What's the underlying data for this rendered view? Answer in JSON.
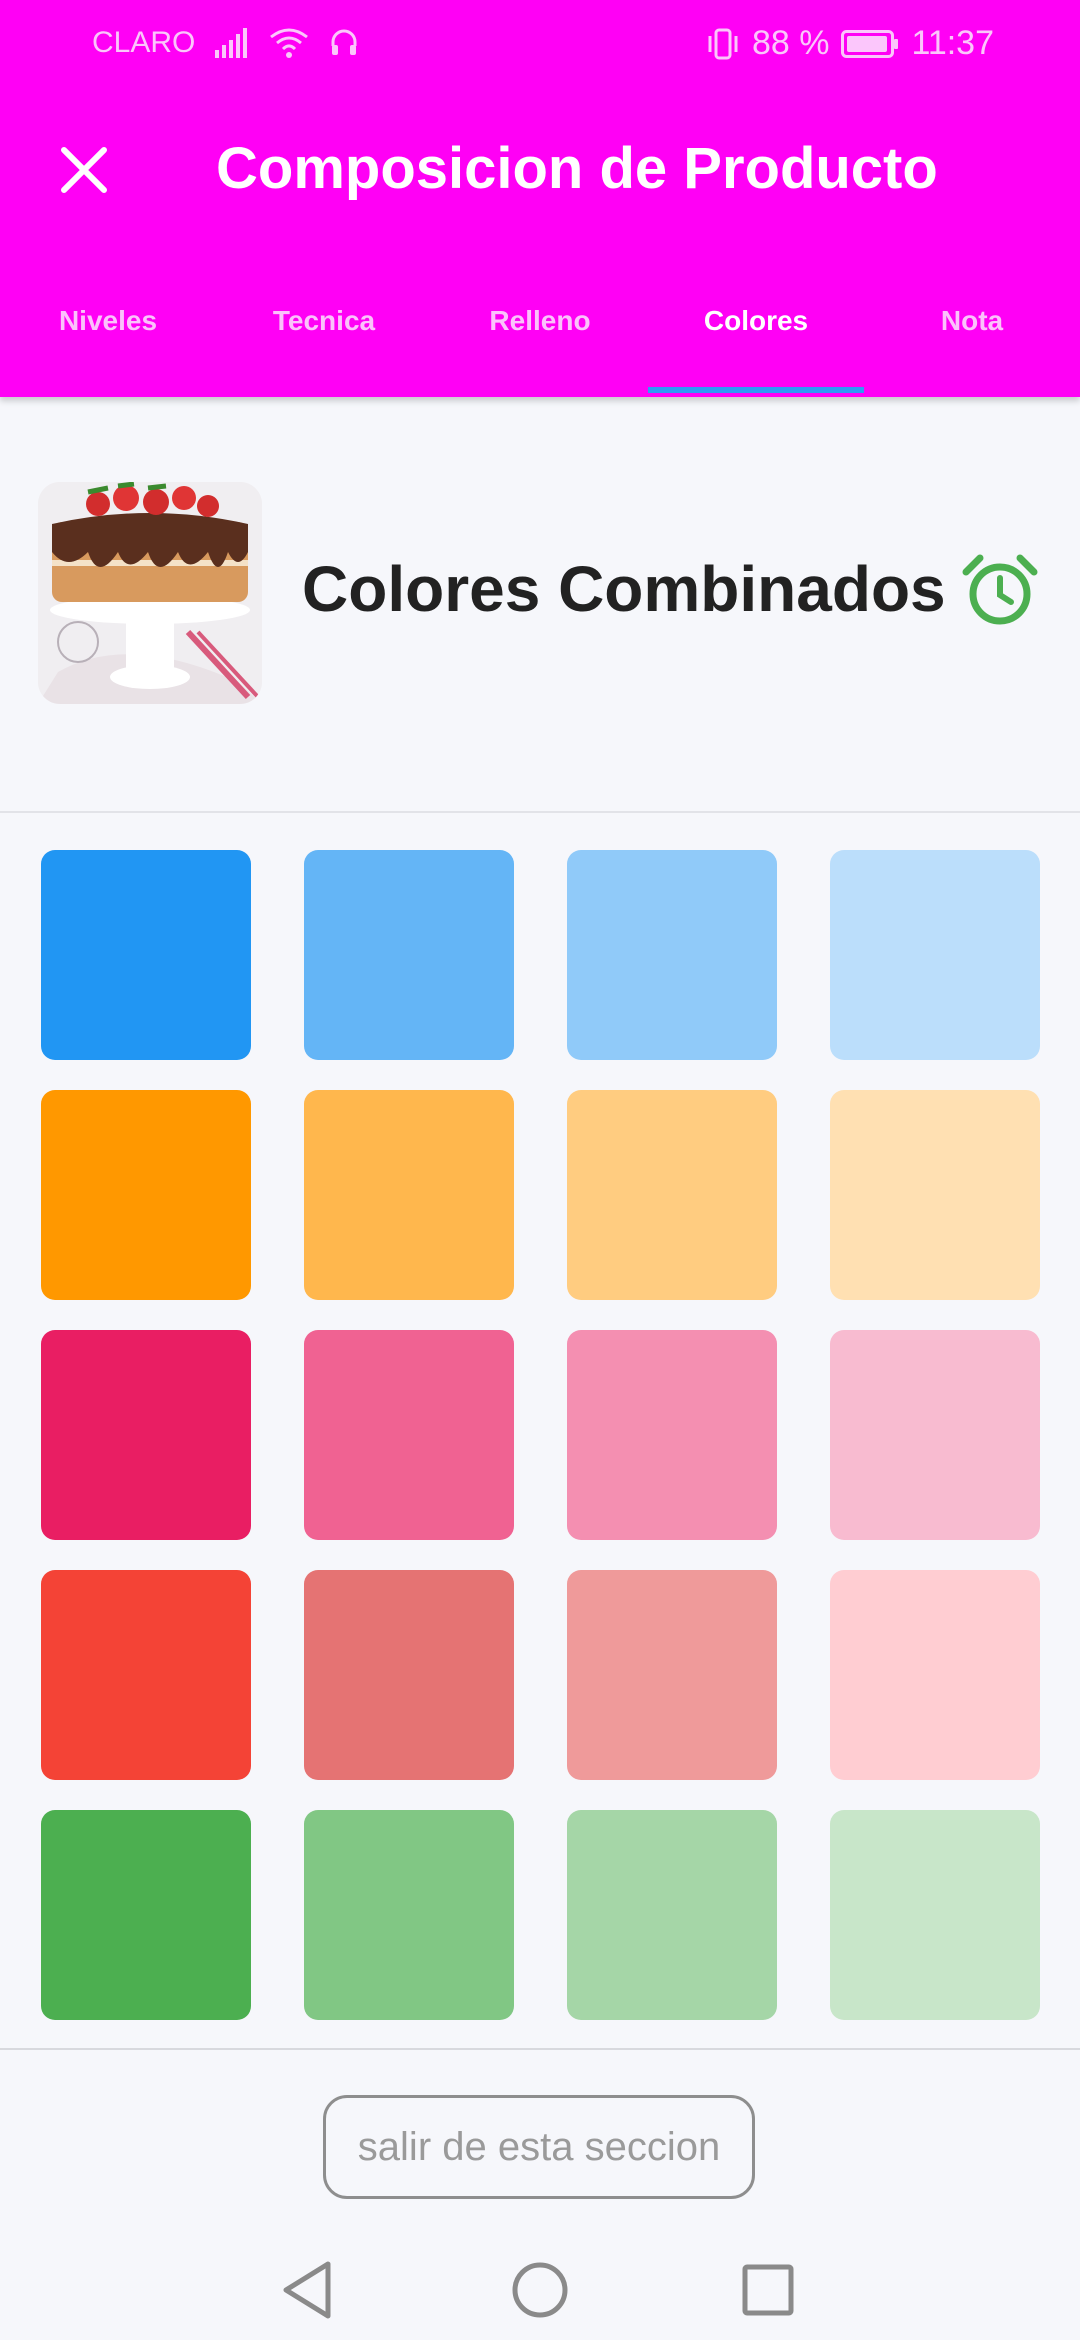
{
  "status_bar": {
    "carrier": "CLARO",
    "battery": "88 %",
    "time": "11:37",
    "icons": [
      "signal-icon",
      "wifi-icon",
      "headset-icon",
      "vibrate-icon",
      "battery-icon"
    ]
  },
  "header": {
    "title": "Composicion de Producto",
    "close_icon": "close-icon"
  },
  "tabs": [
    {
      "label": "Niveles",
      "active": false
    },
    {
      "label": "Tecnica",
      "active": false
    },
    {
      "label": "Relleno",
      "active": false
    },
    {
      "label": "Colores",
      "active": true
    },
    {
      "label": "Nota",
      "active": false
    }
  ],
  "product": {
    "title": "Colores Combinados",
    "image": "cake-thumbnail",
    "alarm_icon": "alarm-clock-icon",
    "alarm_color": "#4caf50"
  },
  "swatches": [
    [
      "#2196f3",
      "#64b5f6",
      "#90caf9",
      "#bbdefb"
    ],
    [
      "#ff9800",
      "#ffb74d",
      "#ffcc80",
      "#ffe0b2"
    ],
    [
      "#e91e63",
      "#f06292",
      "#f48fb1",
      "#f8bbd0"
    ],
    [
      "#f44336",
      "#e57373",
      "#ef9a9a",
      "#ffcdd2"
    ],
    [
      "#4caf50",
      "#81c784",
      "#a5d6a7",
      "#c8e6c9"
    ]
  ],
  "footer": {
    "exit_label": "salir de esta seccion"
  },
  "nav_bar": {
    "icons": [
      "back-icon",
      "home-icon",
      "recents-icon"
    ]
  },
  "colors": {
    "header_bg": "#ff00f5",
    "tab_indicator": "#2f9bf4",
    "page_bg": "#f6f7fb"
  }
}
